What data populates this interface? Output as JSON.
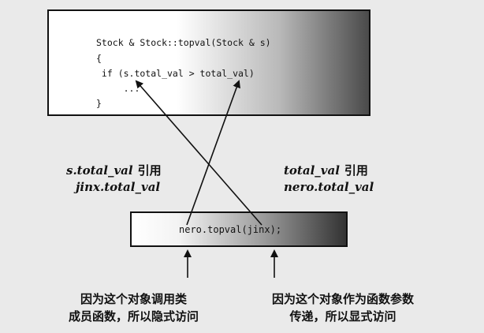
{
  "code": {
    "lines": [
      "Stock & Stock::topval(Stock & s)",
      "{",
      " if (s.total_val > total_val)",
      "     ...",
      "}"
    ]
  },
  "call": {
    "text": "nero.topval(jinx);"
  },
  "labels": {
    "left_ref": "s.total_val",
    "left_ref_word": "引用",
    "left_target": "jinx.total_val",
    "right_ref": "total_val",
    "right_ref_word": "引用",
    "right_target": "nero.total_val"
  },
  "notes": {
    "left_line1": "因为这个对象调用类",
    "left_line2": "成员函数，所以隐式访问",
    "right_line1": "因为这个对象作为函数参数",
    "right_line2": "传递，所以显式访问"
  }
}
